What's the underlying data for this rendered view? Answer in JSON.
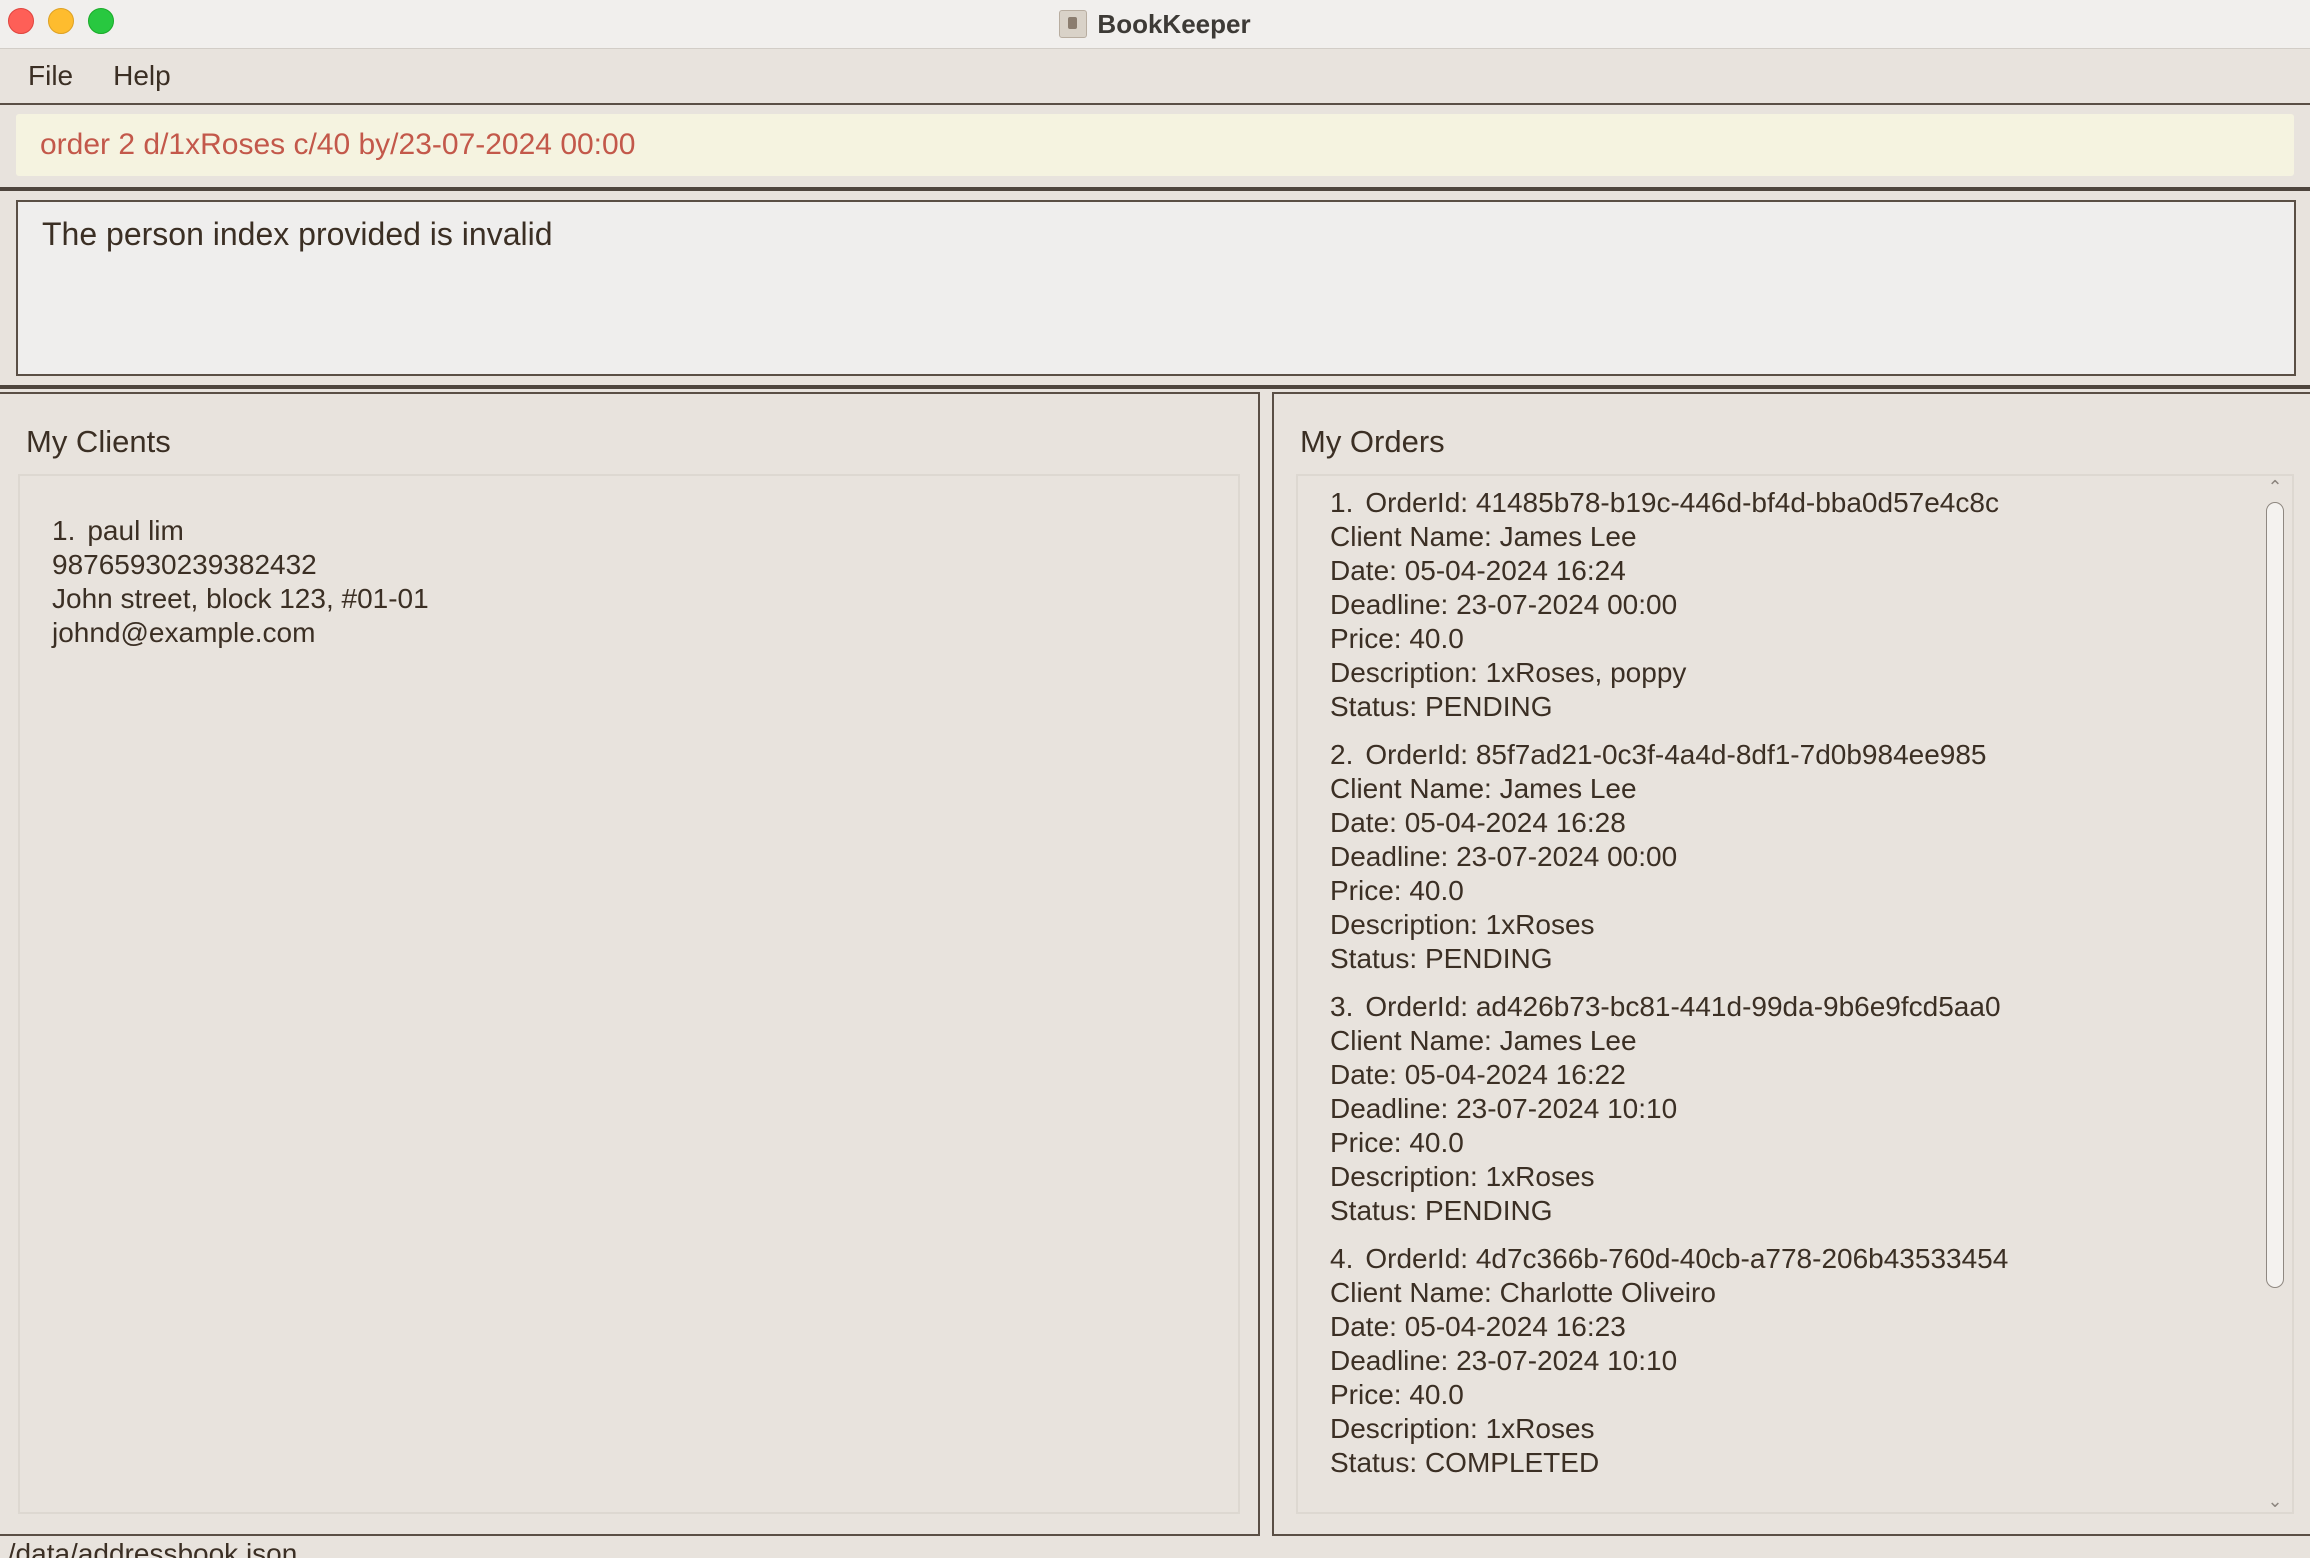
{
  "window": {
    "title": "BookKeeper"
  },
  "menu": {
    "file": "File",
    "help": "Help"
  },
  "command": {
    "value": "order 2 d/1xRoses c/40 by/23-07-2024 00:00"
  },
  "result": {
    "message": "The person index provided is invalid"
  },
  "clients": {
    "title": "My Clients",
    "items": [
      {
        "index": "1.",
        "name": "paul lim",
        "phone": "98765930239382432",
        "address": "John street, block 123, #01-01",
        "email": "johnd@example.com"
      }
    ]
  },
  "orders": {
    "title": "My Orders",
    "items": [
      {
        "index": "1.",
        "id": "OrderId: 41485b78-b19c-446d-bf4d-bba0d57e4c8c",
        "client": "Client Name: James Lee",
        "date": "Date: 05-04-2024 16:24",
        "deadline": "Deadline: 23-07-2024 00:00",
        "price": "Price: 40.0",
        "description": "Description: 1xRoses, poppy",
        "status": "Status: PENDING"
      },
      {
        "index": "2.",
        "id": "OrderId: 85f7ad21-0c3f-4a4d-8df1-7d0b984ee985",
        "client": "Client Name: James Lee",
        "date": "Date: 05-04-2024 16:28",
        "deadline": "Deadline: 23-07-2024 00:00",
        "price": "Price: 40.0",
        "description": "Description: 1xRoses",
        "status": "Status: PENDING"
      },
      {
        "index": "3.",
        "id": "OrderId: ad426b73-bc81-441d-99da-9b6e9fcd5aa0",
        "client": "Client Name: James Lee",
        "date": "Date: 05-04-2024 16:22",
        "deadline": "Deadline: 23-07-2024 10:10",
        "price": "Price: 40.0",
        "description": "Description: 1xRoses",
        "status": "Status: PENDING"
      },
      {
        "index": "4.",
        "id": "OrderId: 4d7c366b-760d-40cb-a778-206b43533454",
        "client": "Client Name: Charlotte Oliveiro",
        "date": "Date: 05-04-2024 16:23",
        "deadline": "Deadline: 23-07-2024 10:10",
        "price": "Price: 40.0",
        "description": "Description: 1xRoses",
        "status": "Status: COMPLETED"
      }
    ]
  },
  "statusbar": {
    "path": "./data/addressbook.json"
  },
  "colors": {
    "command_text": "#c3584a",
    "command_bg": "#f5f3e0",
    "panel_bg": "#e8e3dd",
    "border": "#5a4f45"
  },
  "icons": {
    "close": "close-traffic-light",
    "minimize": "minimize-traffic-light",
    "maximize": "maximize-traffic-light",
    "app": "book-icon",
    "scroll_up": "chevron-up-icon",
    "scroll_down": "chevron-down-icon"
  }
}
